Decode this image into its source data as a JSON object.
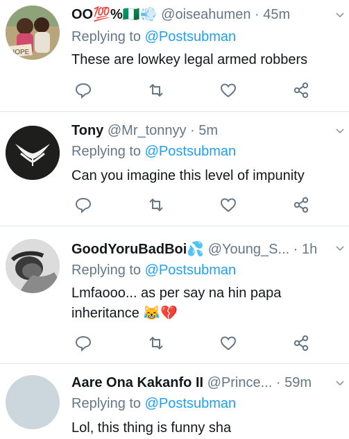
{
  "tweets": [
    {
      "display_name": "OO💯%🇳🇬💨",
      "handle": "@oiseahumen",
      "time": "· 45m",
      "replying_prefix": "Replying to",
      "replying_to": "@Postsubman",
      "text": "These are lowkey legal armed robbers",
      "avatar_sign": "HOPE"
    },
    {
      "display_name": "Tony",
      "handle": "@Mr_tonnyy",
      "time": "· 5m",
      "replying_prefix": "Replying to",
      "replying_to": "@Postsubman",
      "text": "Can you imagine this level of impunity"
    },
    {
      "display_name": "GoodYoruBadBoi💦",
      "handle": "@Young_S...",
      "time": "· 1h",
      "replying_prefix": "Replying to",
      "replying_to": "@Postsubman",
      "text_line1": "Lmfaooo... as per say na hin papa",
      "text_line2": "inheritance 😹💔"
    },
    {
      "display_name": "Aare Ona Kakanfo II",
      "handle": "@Prince...",
      "time": "· 59m",
      "replying_prefix": "Replying to",
      "replying_to": "@Postsubman",
      "text": "Lol, this thing is funny sha"
    }
  ],
  "colors": {
    "accent": "#1da1f2",
    "muted": "#657786",
    "text": "#14171a",
    "divider": "#e1e8ed"
  },
  "icons": [
    "reply-icon",
    "retweet-icon",
    "like-icon",
    "share-icon",
    "chevron-down-icon"
  ]
}
